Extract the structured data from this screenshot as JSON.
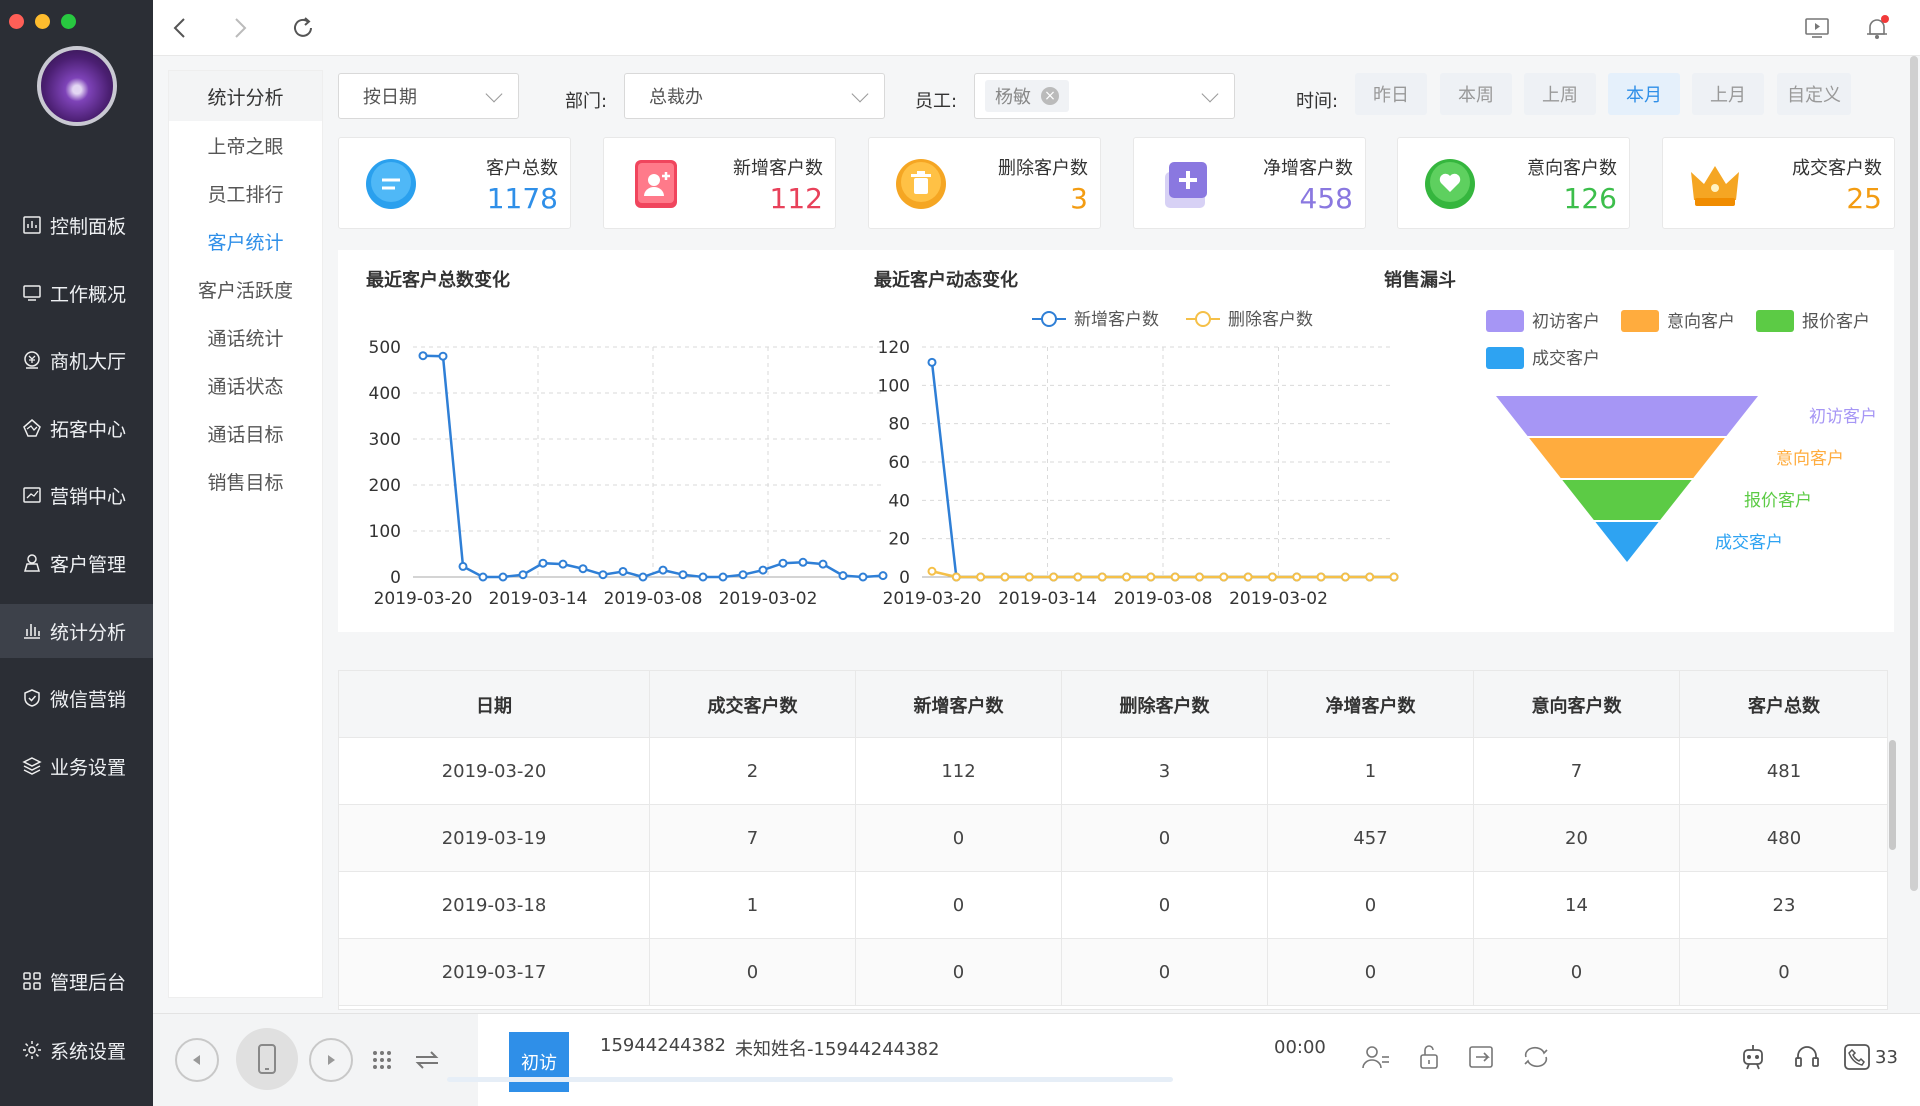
{
  "window": {
    "traffic_lights": [
      "#ff5f57",
      "#febc2e",
      "#28c840"
    ]
  },
  "nav": [
    {
      "label": "控制面板",
      "icon": "dashboard-icon",
      "active": false
    },
    {
      "label": "工作概况",
      "icon": "monitor-icon",
      "active": false
    },
    {
      "label": "商机大厅",
      "icon": "money-icon",
      "active": false
    },
    {
      "label": "拓客中心",
      "icon": "radar-icon",
      "active": false
    },
    {
      "label": "营销中心",
      "icon": "trend-icon",
      "active": false
    },
    {
      "label": "客户管理",
      "icon": "user-icon",
      "active": false
    },
    {
      "label": "统计分析",
      "icon": "bar-chart-icon",
      "active": true
    },
    {
      "label": "微信营销",
      "icon": "shield-icon",
      "active": false
    },
    {
      "label": "业务设置",
      "icon": "layers-icon",
      "active": false
    }
  ],
  "nav_bottom": [
    {
      "label": "管理后台",
      "icon": "grid-icon"
    },
    {
      "label": "系统设置",
      "icon": "gear-icon"
    }
  ],
  "submenu": {
    "title": "统计分析",
    "items": [
      "上帝之眼",
      "员工排行",
      "客户统计",
      "客户活跃度",
      "通话统计",
      "通话状态",
      "通话目标",
      "销售目标"
    ],
    "active_index": 2
  },
  "filters": {
    "mode": "按日期",
    "dept_label": "部门:",
    "dept": "总裁办",
    "staff_label": "员工:",
    "staff_tag": "杨敏",
    "time_label": "时间:",
    "time_buttons": [
      "昨日",
      "本周",
      "上周",
      "本月",
      "上月",
      "自定义"
    ],
    "time_active": "本月"
  },
  "stats": [
    {
      "label": "客户总数",
      "value": "1178",
      "color": "#2f8fe8",
      "icon": "chat-bubble-icon"
    },
    {
      "label": "新增客户数",
      "value": "112",
      "color": "#e8415a",
      "icon": "add-user-icon"
    },
    {
      "label": "删除客户数",
      "value": "3",
      "color": "#f39c12",
      "icon": "trash-icon"
    },
    {
      "label": "净增客户数",
      "value": "458",
      "color": "#8a78e0",
      "icon": "plus-box-icon"
    },
    {
      "label": "意向客户数",
      "value": "126",
      "color": "#3cbe4b",
      "icon": "heart-icon"
    },
    {
      "label": "成交客户数",
      "value": "25",
      "color": "#f39c12",
      "icon": "crown-icon"
    }
  ],
  "charts": {
    "total_title": "最近客户总数变化",
    "dynamic_title": "最近客户动态变化",
    "funnel_title": "销售漏斗",
    "legend_new": "新增客户数",
    "legend_del": "删除客户数"
  },
  "chart_data": [
    {
      "type": "line",
      "title": "最近客户总数变化",
      "x_ticks": [
        "2019-03-20",
        "2019-03-14",
        "2019-03-08",
        "2019-03-02"
      ],
      "ylim": [
        0,
        500
      ],
      "y_ticks": [
        0,
        100,
        200,
        300,
        400,
        500
      ],
      "series": [
        {
          "values": [
            481,
            480,
            23,
            0,
            0,
            5,
            30,
            28,
            18,
            5,
            12,
            0,
            15,
            5,
            0,
            0,
            5,
            15,
            30,
            32,
            28,
            3,
            0,
            3
          ]
        }
      ],
      "color": "#2f7fd6"
    },
    {
      "type": "line",
      "title": "最近客户动态变化",
      "x_ticks": [
        "2019-03-20",
        "2019-03-14",
        "2019-03-08",
        "2019-03-02"
      ],
      "ylim": [
        0,
        120
      ],
      "y_ticks": [
        0,
        20,
        40,
        60,
        80,
        100,
        120
      ],
      "series": [
        {
          "name": "新增客户数",
          "color": "#2f7fd6",
          "values": [
            112,
            0,
            0,
            0,
            0,
            0,
            0,
            0,
            0,
            0,
            0,
            0,
            0,
            0,
            0,
            0,
            0,
            0,
            0,
            0
          ]
        },
        {
          "name": "删除客户数",
          "color": "#f5c048",
          "values": [
            3,
            0,
            0,
            0,
            0,
            0,
            0,
            0,
            0,
            0,
            0,
            0,
            0,
            0,
            0,
            0,
            0,
            0,
            0,
            0
          ]
        }
      ]
    },
    {
      "type": "funnel",
      "title": "销售漏斗",
      "categories": [
        "初访客户",
        "意向客户",
        "报价客户",
        "成交客户"
      ],
      "colors": [
        "#a696f5",
        "#ffac3e",
        "#5ccb45",
        "#2ea3f2"
      ]
    }
  ],
  "table": {
    "headers": [
      "日期",
      "成交客户数",
      "新增客户数",
      "删除客户数",
      "净增客户数",
      "意向客户数",
      "客户总数"
    ],
    "rows": [
      [
        "2019-03-20",
        "2",
        "112",
        "3",
        "1",
        "7",
        "481"
      ],
      [
        "2019-03-19",
        "7",
        "0",
        "0",
        "457",
        "20",
        "480"
      ],
      [
        "2019-03-18",
        "1",
        "0",
        "0",
        "0",
        "14",
        "23"
      ],
      [
        "2019-03-17",
        "0",
        "0",
        "0",
        "0",
        "0",
        "0"
      ]
    ]
  },
  "call": {
    "badge": "初访",
    "phone": "15944244382",
    "name": "未知姓名-15944244382",
    "timer": "00:00",
    "count": "33"
  }
}
